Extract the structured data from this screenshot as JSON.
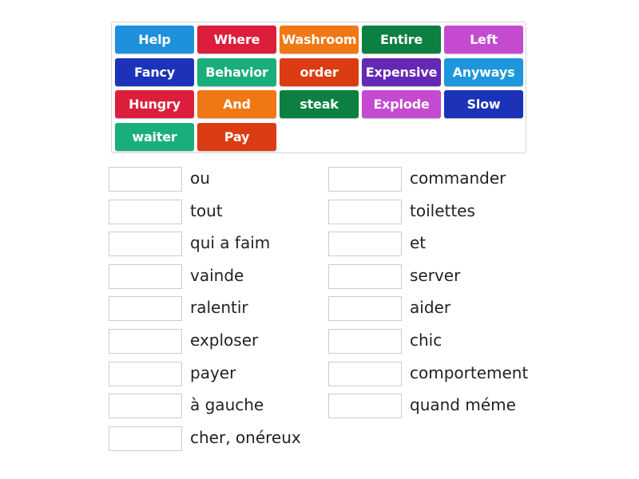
{
  "tile_bank": {
    "tiles": [
      {
        "label": "Help",
        "color": "#1e90dc"
      },
      {
        "label": "Where",
        "color": "#dc1e3c"
      },
      {
        "label": "Washroom",
        "color": "#f07814"
      },
      {
        "label": "Entire",
        "color": "#0c8040"
      },
      {
        "label": "Left",
        "color": "#c44bd0"
      },
      {
        "label": "Fancy",
        "color": "#1c32b8"
      },
      {
        "label": "Behavior",
        "color": "#1aae7c"
      },
      {
        "label": "order",
        "color": "#dc3c14"
      },
      {
        "label": "Expensive",
        "color": "#6428b4"
      },
      {
        "label": "Anyways",
        "color": "#1e96dc"
      },
      {
        "label": "Hungry",
        "color": "#dc1e3c"
      },
      {
        "label": "And",
        "color": "#f07814"
      },
      {
        "label": "steak",
        "color": "#0c8040"
      },
      {
        "label": "Explode",
        "color": "#c44bd0"
      },
      {
        "label": "Slow",
        "color": "#1c32b8"
      },
      {
        "label": "waiter",
        "color": "#1aae7c"
      },
      {
        "label": "Pay",
        "color": "#dc3c14"
      }
    ]
  },
  "targets": {
    "left_column": [
      {
        "label": "ou",
        "value": ""
      },
      {
        "label": "tout",
        "value": ""
      },
      {
        "label": "qui a faim",
        "value": ""
      },
      {
        "label": "vainde",
        "value": ""
      },
      {
        "label": "ralentir",
        "value": ""
      },
      {
        "label": "exploser",
        "value": ""
      },
      {
        "label": "payer",
        "value": ""
      },
      {
        "label": "à gauche",
        "value": ""
      },
      {
        "label": "cher, onéreux",
        "value": ""
      }
    ],
    "right_column": [
      {
        "label": "commander",
        "value": ""
      },
      {
        "label": "toilettes",
        "value": ""
      },
      {
        "label": "et",
        "value": ""
      },
      {
        "label": "server",
        "value": ""
      },
      {
        "label": "aider",
        "value": ""
      },
      {
        "label": "chic",
        "value": ""
      },
      {
        "label": "comportement",
        "value": ""
      },
      {
        "label": "quand méme",
        "value": ""
      }
    ]
  }
}
